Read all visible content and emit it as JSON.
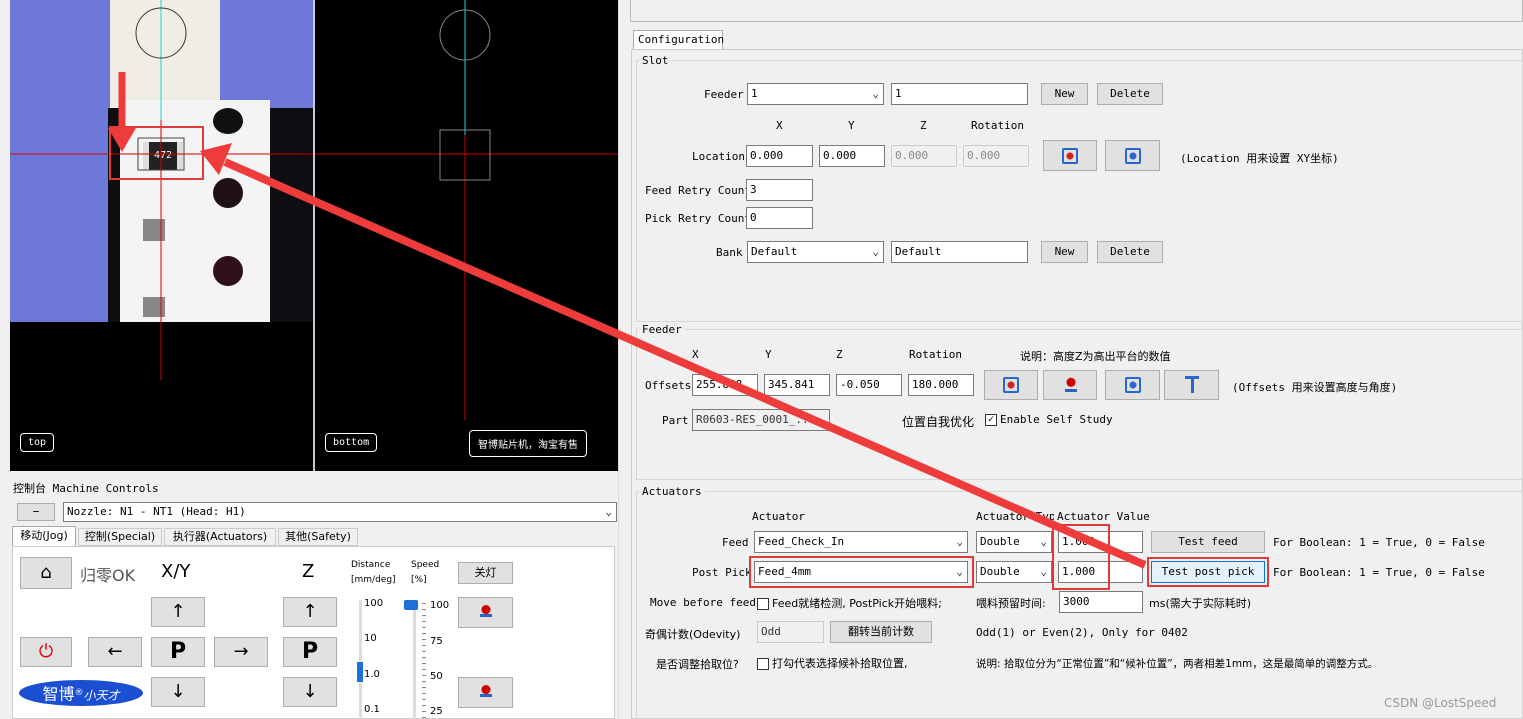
{
  "camera": {
    "top_label": "top",
    "bottom_label": "bottom",
    "ad_text": "智博贴片机，淘宝有售",
    "component_text": "472"
  },
  "machine": {
    "title": "控制台 Machine Controls",
    "collapse": "−",
    "nozzle": "Nozzle: N1 - NT1 (Head: H1)",
    "tabs": [
      "移动(Jog)",
      "控制(Special)",
      "执行器(Actuators)",
      "其他(Safety)"
    ],
    "home_ok": "归零OK",
    "xy": "X/Y",
    "z": "Z",
    "distance": "Distance",
    "distance_unit": "[mm/deg]",
    "speed": "Speed",
    "speed_unit": "[%]",
    "light": "关灯",
    "dist_ticks": [
      "100",
      "10",
      "1.0",
      "0.1"
    ],
    "speed_ticks": [
      "100",
      "75",
      "50",
      "25"
    ],
    "distance_value": "1.0",
    "speed_value": 100,
    "brand": "智博",
    "brand_sup": "®",
    "brand_sub": "小天才",
    "p": "P"
  },
  "config": {
    "tab": "Configuration",
    "slot": {
      "title": "Slot",
      "feeder_label": "Feeder",
      "feeder_sel": "1",
      "feeder_name": "1",
      "new": "New",
      "delete": "Delete",
      "x": "X",
      "y": "Y",
      "z": "Z",
      "rotation": "Rotation",
      "location_label": "Location",
      "loc_x": "0.000",
      "loc_y": "0.000",
      "loc_z": "0.000",
      "loc_r": "0.000",
      "location_note": "(Location 用来设置 XY坐标)",
      "feed_retry_label": "Feed Retry Count",
      "feed_retry": "3",
      "pick_retry_label": "Pick Retry Count",
      "pick_retry": "0",
      "bank_label": "Bank",
      "bank_sel": "Default",
      "bank_name": "Default"
    },
    "feeder": {
      "title": "Feeder",
      "x": "X",
      "y": "Y",
      "z": "Z",
      "rotation": "Rotation",
      "note": "说明：高度Z为高出平台的数值",
      "offsets_label": "Offsets",
      "off_x": "255.868",
      "off_y": "345.841",
      "off_z": "-0.050",
      "off_r": "180.000",
      "offsets_note": "(Offsets 用来设置高度与角度)",
      "part_label": "Part",
      "part": "R0603-RES_0001_...",
      "self_opt": "位置自我优化",
      "enable_self_study": "Enable Self Study"
    },
    "actuators": {
      "title": "Actuators",
      "col_actuator": "Actuator",
      "col_type": "Actuator Type",
      "col_value": "Actuator Value",
      "feed_label": "Feed",
      "feed_actuator": "Feed_Check_In",
      "feed_type": "Double",
      "feed_value": "1.000",
      "test_feed": "Test feed",
      "feed_note": "For Boolean: 1 = True, 0 = False",
      "postpick_label": "Post Pick",
      "postpick_actuator": "Feed_4mm",
      "postpick_type": "Double",
      "postpick_value": "1.000",
      "test_postpick": "Test post pick",
      "postpick_note": "For Boolean: 1 = True, 0 = False",
      "move_before_feed": "Move before feed",
      "feed_check": "Feed就绪检测, PostPick开始喂料;",
      "reserve_label": "喂料预留时间:",
      "reserve_value": "3000",
      "reserve_unit": "ms(需大于实际耗时)",
      "parity_label": "奇偶计数(Odevity)",
      "parity_value": "Odd",
      "flip_btn": "翻转当前计数",
      "parity_note": "Odd(1) or Even(2), Only for 0402",
      "adjust_label": "是否调整拾取位?",
      "adjust_check": "打勾代表选择候补拾取位置,",
      "adjust_note": "说明: 拾取位分为“正常位置”和“候补位置”，两者相差1mm，这是最简单的调整方式。"
    }
  },
  "watermark": "CSDN @LostSpeed",
  "colors": {
    "crosshair": "#d40000",
    "cyan": "#19d3e0",
    "annotation": "#ee3b3b"
  }
}
